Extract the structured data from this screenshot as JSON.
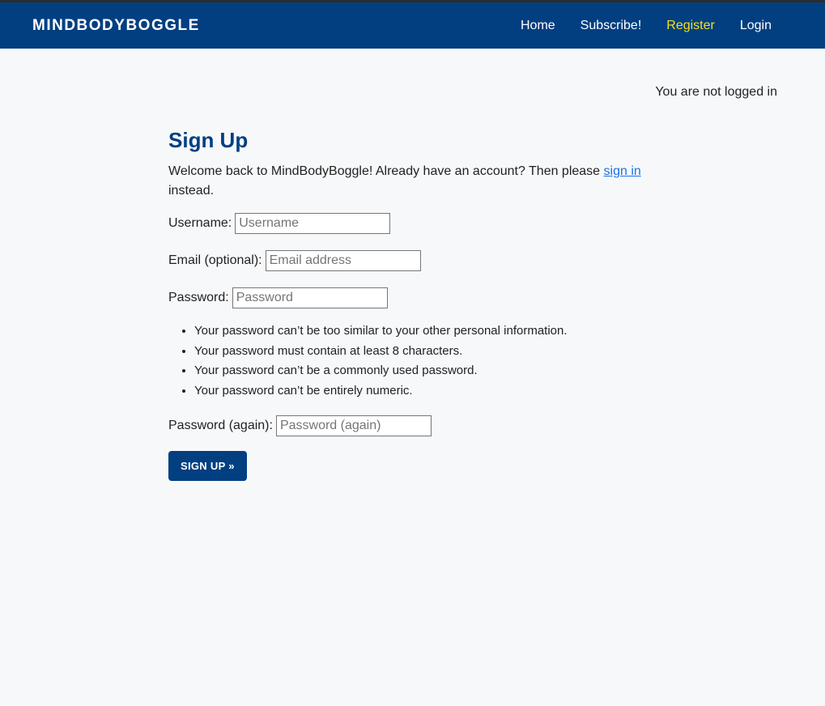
{
  "nav": {
    "brand": "MINDBODYBOGGLE",
    "links": [
      {
        "label": "Home"
      },
      {
        "label": "Subscribe!"
      },
      {
        "label": "Register"
      },
      {
        "label": "Login"
      }
    ],
    "active_color": "#f3e21b",
    "bar_color": "#013f81"
  },
  "status": {
    "login_text": "You are not logged in"
  },
  "signup": {
    "title": "Sign Up",
    "intro_before": "Welcome back to MindBodyBoggle! Already have an account? Then please ",
    "intro_link": "sign in",
    "intro_after": " instead.",
    "username_label": "Username:",
    "username_placeholder": "Username",
    "email_label": "Email (optional):",
    "email_placeholder": "Email address",
    "password_label": "Password:",
    "password_placeholder": "Password",
    "password_rules": [
      "Your password can’t be too similar to your other personal information.",
      "Your password must contain at least 8 characters.",
      "Your password can’t be a commonly used password.",
      "Your password can’t be entirely numeric."
    ],
    "password2_label": "Password (again):",
    "password2_placeholder": "Password (again)",
    "submit_label": "SIGN UP »"
  }
}
